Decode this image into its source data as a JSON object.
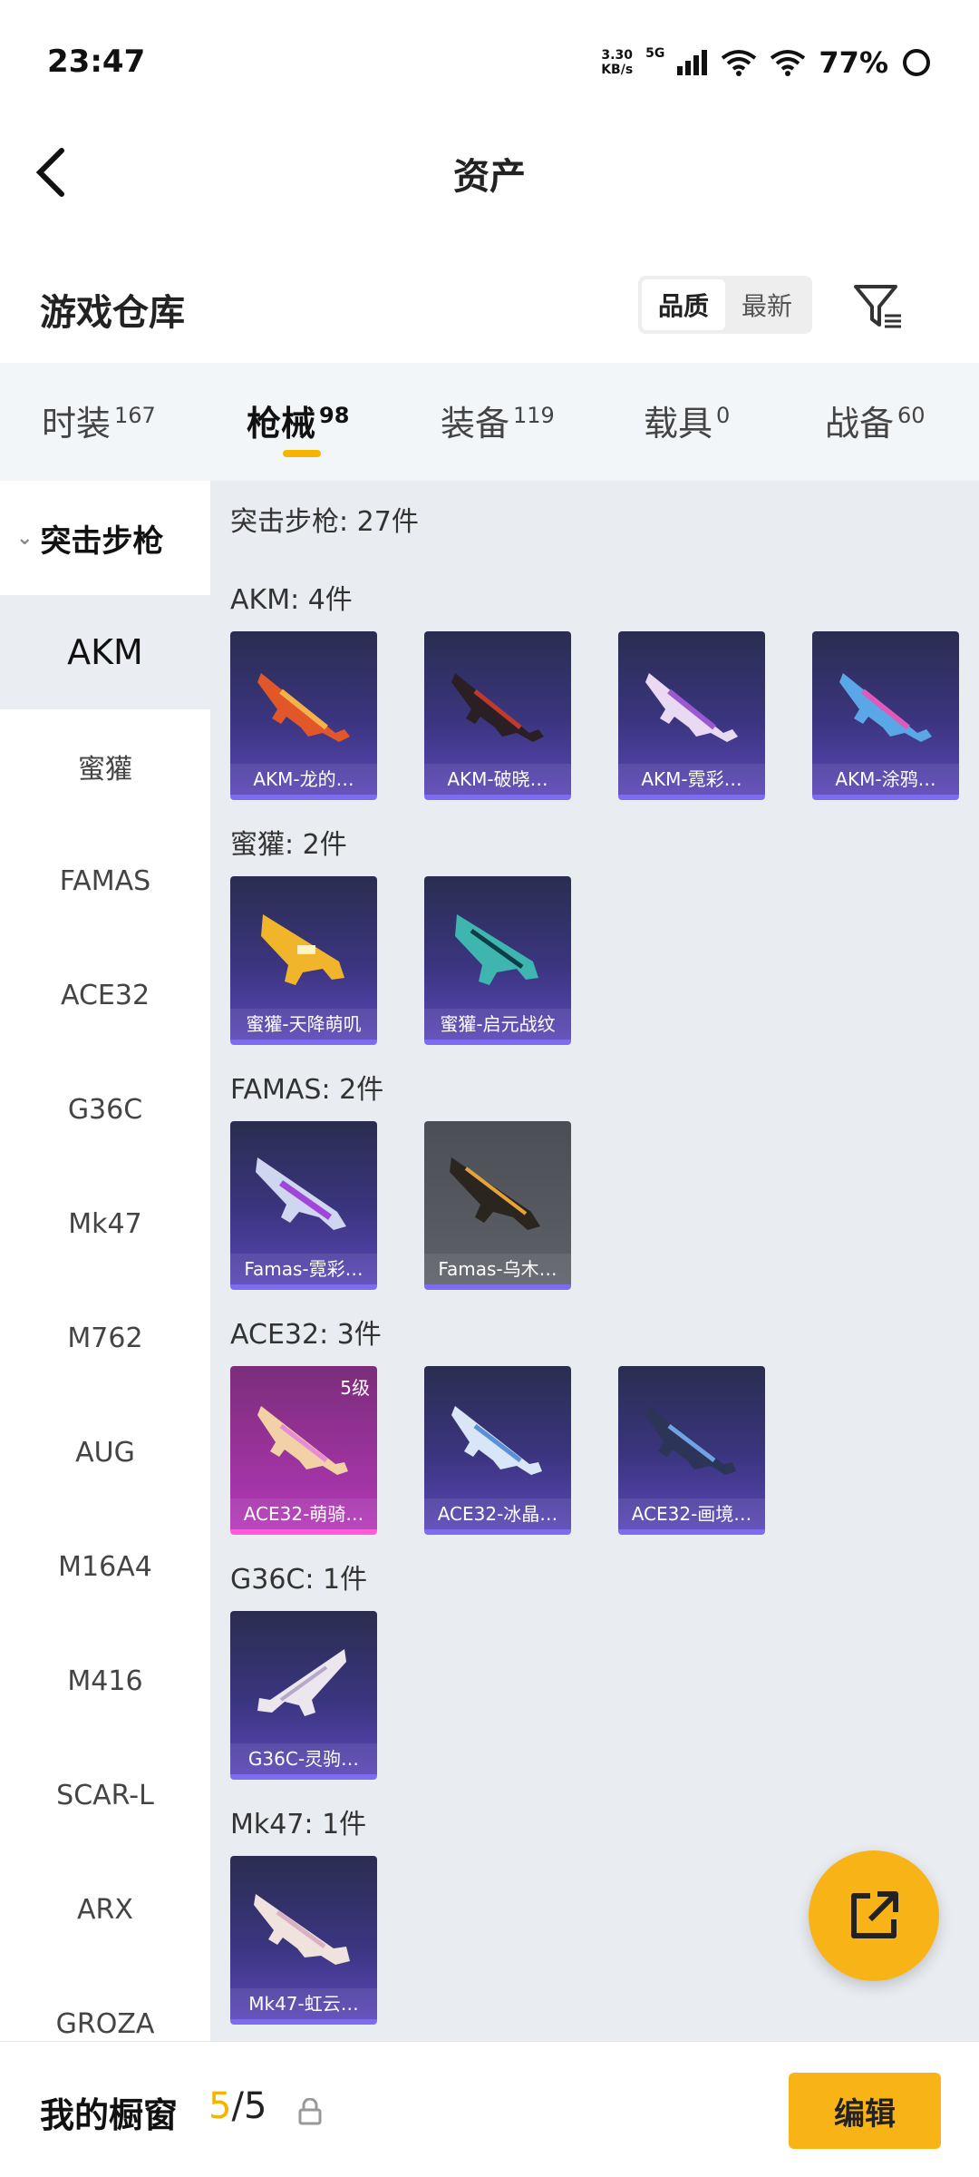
{
  "status_bar": {
    "time": "23:47",
    "net_speed_value": "3.30",
    "net_speed_unit": "KB/s",
    "network": "5G",
    "battery": "77%"
  },
  "header": {
    "title": "资产"
  },
  "section": {
    "title": "游戏仓库",
    "sort_options": [
      "品质",
      "最新"
    ],
    "active_sort": "品质"
  },
  "tabs": [
    {
      "label": "时装",
      "count": "167"
    },
    {
      "label": "枪械",
      "count": "98",
      "active": true
    },
    {
      "label": "装备",
      "count": "119"
    },
    {
      "label": "载具",
      "count": "0"
    },
    {
      "label": "战备",
      "count": "60"
    }
  ],
  "sidebar": {
    "group": "突击步枪",
    "items": [
      "AKM",
      "蜜獾",
      "FAMAS",
      "ACE32",
      "G36C",
      "Mk47",
      "M762",
      "AUG",
      "M16A4",
      "M416",
      "SCAR-L",
      "ARX",
      "GROZA"
    ],
    "active": "AKM"
  },
  "content": {
    "header": "突击步枪: 27件",
    "groups": [
      {
        "label": "AKM: 4件",
        "cards": [
          "AKM-龙的…",
          "AKM-破晓…",
          "AKM-霓彩…",
          "AKM-涂鸦…"
        ]
      },
      {
        "label": "蜜獾: 2件",
        "cards": [
          "蜜獾-天降萌叽",
          "蜜獾-启元战纹"
        ]
      },
      {
        "label": "FAMAS: 2件",
        "cards": [
          "Famas-霓彩…",
          "Famas-乌木…"
        ]
      },
      {
        "label": "ACE32: 3件",
        "cards": [
          "ACE32-萌骑…",
          "ACE32-冰晶…",
          "ACE32-画境…"
        ],
        "badge": "5级"
      },
      {
        "label": "G36C: 1件",
        "cards": [
          "G36C-灵驹…"
        ]
      },
      {
        "label": "Mk47: 1件",
        "cards": [
          "Mk47-虹云…"
        ]
      }
    ]
  },
  "bottom_bar": {
    "title": "我的橱窗",
    "count_current": "5",
    "count_sep": "/",
    "count_total": "5",
    "edit_label": "编辑"
  },
  "colors": {
    "accent": "#f8b416",
    "card_purple": "#3b3580",
    "card_pink": "#b238b7"
  },
  "icons": {
    "back": "chevron-left-icon",
    "filter": "filter-icon",
    "share": "share-external-icon",
    "lock": "lock-icon"
  }
}
